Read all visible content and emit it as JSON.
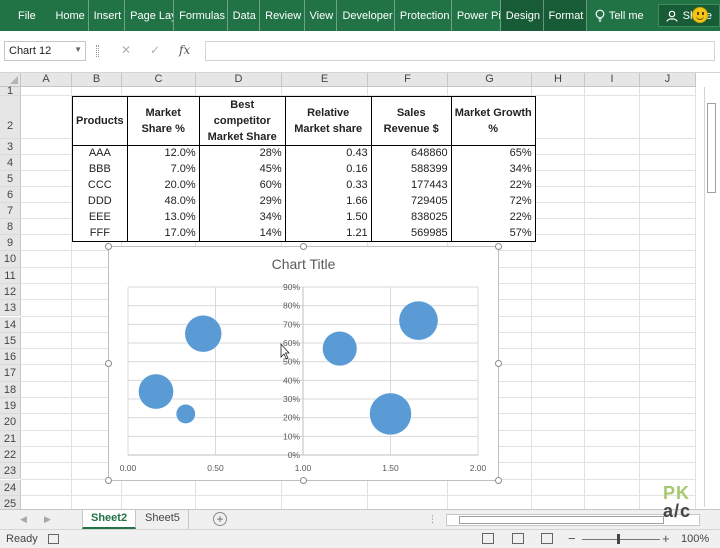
{
  "ribbon": {
    "tabs": [
      "File",
      "Home",
      "Insert",
      "Page Layo",
      "Formulas",
      "Data",
      "Review",
      "View",
      "Developer",
      "Protection",
      "Power Pivo",
      "Design",
      "Format"
    ],
    "tell_me": "Tell me",
    "share": "Share"
  },
  "formula_bar": {
    "name_box": "Chart 12",
    "cancel_icon": "✕",
    "enter_icon": "✓",
    "fx_label": "fx",
    "formula": ""
  },
  "columns": [
    "A",
    "B",
    "C",
    "D",
    "E",
    "F",
    "G",
    "H",
    "I",
    "J"
  ],
  "rows": [
    "1",
    "2",
    "3",
    "4",
    "5",
    "6",
    "7",
    "8",
    "9",
    "10",
    "11",
    "12",
    "13",
    "14",
    "15",
    "16",
    "17",
    "18",
    "19",
    "20",
    "21",
    "22",
    "23",
    "24",
    "25"
  ],
  "table": {
    "headers": [
      "Products",
      "Market Share %",
      "Best competitor Market Share",
      "Relative Market share",
      "Sales Revenue $",
      "Market Growth %"
    ],
    "rows": [
      [
        "AAA",
        "12.0%",
        "28%",
        "0.43",
        "648860",
        "65%"
      ],
      [
        "BBB",
        "7.0%",
        "45%",
        "0.16",
        "588399",
        "34%"
      ],
      [
        "CCC",
        "20.0%",
        "60%",
        "0.33",
        "177443",
        "22%"
      ],
      [
        "DDD",
        "48.0%",
        "29%",
        "1.66",
        "729405",
        "72%"
      ],
      [
        "EEE",
        "13.0%",
        "34%",
        "1.50",
        "838025",
        "22%"
      ],
      [
        "FFF",
        "17.0%",
        "14%",
        "1.21",
        "569985",
        "57%"
      ]
    ]
  },
  "chart_data": {
    "type": "scatter",
    "title": "Chart Title",
    "xlabel": "",
    "ylabel": "",
    "xlim": [
      0,
      2
    ],
    "ylim": [
      0,
      0.9
    ],
    "x_ticks": [
      "0.00",
      "0.50",
      "1.00",
      "1.50",
      "2.00"
    ],
    "y_ticks": [
      "0%",
      "10%",
      "20%",
      "30%",
      "40%",
      "50%",
      "60%",
      "70%",
      "80%",
      "90%"
    ],
    "y_axis_crosses_at_x": 1.0,
    "grid": true,
    "bubble_color": "#5b9bd5",
    "series": [
      {
        "x": [
          0.43,
          0.16,
          0.33,
          1.66,
          1.5,
          1.21
        ],
        "y": [
          0.65,
          0.34,
          0.22,
          0.72,
          0.22,
          0.57
        ],
        "size": [
          648860,
          588399,
          177443,
          729405,
          838025,
          569985
        ]
      }
    ]
  },
  "sheet_tabs": [
    "Sheet2",
    "Sheet5"
  ],
  "active_sheet": "Sheet2",
  "status": {
    "ready": "Ready",
    "zoom": "100%"
  },
  "watermark": {
    "top": "PK",
    "bottom": "a/c"
  },
  "colors": {
    "ribbon": "#217346",
    "accent": "#217346"
  }
}
